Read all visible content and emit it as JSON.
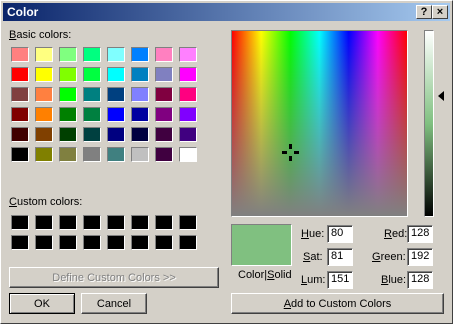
{
  "window": {
    "title": "Color",
    "help_button": "?",
    "close_button": "×"
  },
  "basic_colors": {
    "label": "Basic colors:",
    "label_underline": "B",
    "label_rest": "asic colors:",
    "swatches": [
      "#ff8080",
      "#ffff80",
      "#80ff80",
      "#00ff80",
      "#80ffff",
      "#0080ff",
      "#ff80c0",
      "#ff80ff",
      "#ff0000",
      "#ffff00",
      "#80ff00",
      "#00ff40",
      "#00ffff",
      "#0080c0",
      "#8080c0",
      "#ff00ff",
      "#804040",
      "#ff8040",
      "#00ff00",
      "#008080",
      "#004080",
      "#8080ff",
      "#800040",
      "#ff0080",
      "#800000",
      "#ff8000",
      "#008000",
      "#008040",
      "#0000ff",
      "#0000a0",
      "#800080",
      "#8000ff",
      "#400000",
      "#804000",
      "#004000",
      "#004040",
      "#000080",
      "#000040",
      "#400040",
      "#400080",
      "#000000",
      "#808000",
      "#808040",
      "#808080",
      "#408080",
      "#c0c0c0",
      "#400040",
      "#ffffff"
    ]
  },
  "custom_colors": {
    "label": "Custom colors:",
    "label_underline": "C",
    "label_rest": "ustom colors:",
    "swatches": [
      "#000000",
      "#000000",
      "#000000",
      "#000000",
      "#000000",
      "#000000",
      "#000000",
      "#000000",
      "#000000",
      "#000000",
      "#000000",
      "#000000",
      "#000000",
      "#000000",
      "#000000",
      "#000000"
    ]
  },
  "buttons": {
    "define_custom": "Define Custom Colors >>",
    "ok": "OK",
    "cancel": "Cancel",
    "add_to_custom": "Add to Custom Colors",
    "add_underline": "A",
    "add_rest": "dd to Custom Colors"
  },
  "preview": {
    "color": "#80c080",
    "label_part1": "Color|",
    "label_part1_underline": "S",
    "label_part2": "olid"
  },
  "fields": {
    "hue": {
      "label_u": "H",
      "label_rest": "ue:",
      "value": "80"
    },
    "sat": {
      "label_u": "S",
      "label_rest": "at:",
      "value": "81"
    },
    "lum": {
      "label_u": "L",
      "label_rest": "um:",
      "value": "151"
    },
    "red": {
      "label_u": "R",
      "label_rest": "ed:",
      "value": "128"
    },
    "green": {
      "label_u": "G",
      "label_rest": "reen:",
      "value": "192"
    },
    "blue": {
      "label_u": "B",
      "label_rest": "lue:",
      "value": "128"
    }
  },
  "colors": {
    "face": "#d4d0c8",
    "title_start": "#0a246a",
    "title_end": "#a6caf0"
  }
}
